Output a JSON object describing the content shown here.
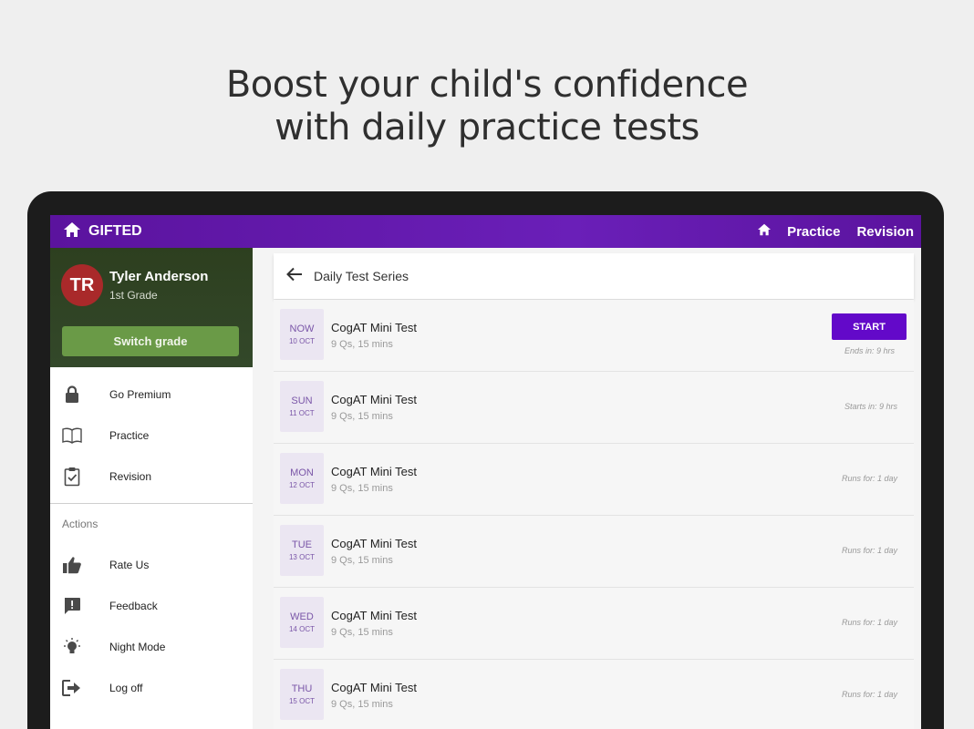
{
  "headline": {
    "line1": "Boost your child's confidence",
    "line2": "with daily practice tests"
  },
  "appbar": {
    "brand": "GIFTED",
    "nav": [
      {
        "label": "Practice"
      },
      {
        "label": "Revision"
      }
    ]
  },
  "colors": {
    "appbar": "#5b139e",
    "profile_bg": "#2d3f1f",
    "switch_button": "#6a9a47",
    "avatar": "#a9292a",
    "start_button": "#6309c9"
  },
  "profile": {
    "initials": "TR",
    "name": "Tyler Anderson",
    "grade": "1st Grade",
    "switch_label": "Switch grade"
  },
  "menu": {
    "items": [
      {
        "label": "Go Premium",
        "icon": "lock-icon"
      },
      {
        "label": "Practice",
        "icon": "book-icon"
      },
      {
        "label": "Revision",
        "icon": "clipboard-check-icon"
      }
    ],
    "actions_title": "Actions",
    "actions": [
      {
        "label": "Rate Us",
        "icon": "thumbs-up-icon"
      },
      {
        "label": "Feedback",
        "icon": "feedback-icon"
      },
      {
        "label": "Night Mode",
        "icon": "lightbulb-icon"
      },
      {
        "label": "Log off",
        "icon": "logout-icon"
      }
    ]
  },
  "content": {
    "title": "Daily Test Series",
    "start_label": "START",
    "tests": [
      {
        "day": "NOW",
        "date": "10 OCT",
        "title": "CogAT Mini Test",
        "meta": "9 Qs, 15 mins",
        "status": "Ends in: 9 hrs"
      },
      {
        "day": "SUN",
        "date": "11 OCT",
        "title": "CogAT Mini Test",
        "meta": "9 Qs, 15 mins",
        "status": "Starts in: 9 hrs"
      },
      {
        "day": "MON",
        "date": "12 OCT",
        "title": "CogAT Mini Test",
        "meta": "9 Qs, 15 mins",
        "status": "Runs for: 1 day"
      },
      {
        "day": "TUE",
        "date": "13 OCT",
        "title": "CogAT Mini Test",
        "meta": "9 Qs, 15 mins",
        "status": "Runs for: 1 day"
      },
      {
        "day": "WED",
        "date": "14 OCT",
        "title": "CogAT Mini Test",
        "meta": "9 Qs, 15 mins",
        "status": "Runs for: 1 day"
      },
      {
        "day": "THU",
        "date": "15 OCT",
        "title": "CogAT Mini Test",
        "meta": "9 Qs, 15 mins",
        "status": "Runs for: 1 day"
      }
    ]
  }
}
